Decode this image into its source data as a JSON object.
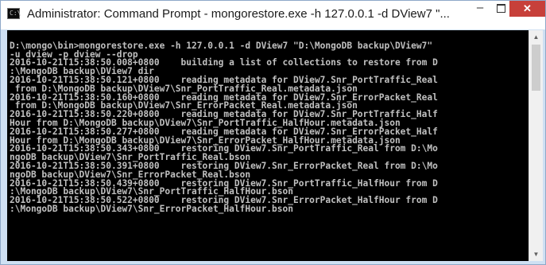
{
  "window": {
    "title": "Administrator: Command Prompt - mongorestore.exe  -h 127.0.0.1 -d DView7 \"...",
    "app_icon": "command-prompt-icon",
    "controls": {
      "minimize_label": "–",
      "close_label": "✕"
    }
  },
  "console": {
    "lines": [
      "",
      "D:\\mongo\\bin>mongorestore.exe -h 127.0.0.1 -d DView7 \"D:\\MongoDB backup\\DView7\"",
      "-u dview -p dview --drop",
      "2016-10-21T15:38:50.008+0800    building a list of collections to restore from D",
      ":\\MongoDB backup\\DView7 dir",
      "2016-10-21T15:38:50.121+0800    reading metadata for DView7.Snr_PortTraffic_Real",
      " from D:\\MongoDB backup\\DView7\\Snr_PortTraffic_Real.metadata.json",
      "2016-10-21T15:38:50.160+0800    reading metadata for DView7.Snr_ErrorPacket_Real",
      " from D:\\MongoDB backup\\DView7\\Snr_ErrorPacket_Real.metadata.json",
      "2016-10-21T15:38:50.220+0800    reading metadata for DView7.Snr_PortTraffic_Half",
      "Hour from D:\\MongoDB backup\\DView7\\Snr_PortTraffic_HalfHour.metadata.json",
      "2016-10-21T15:38:50.277+0800    reading metadata for DView7.Snr_ErrorPacket_Half",
      "Hour from D:\\MongoDB backup\\DView7\\Snr_ErrorPacket_HalfHour.metadata.json",
      "2016-10-21T15:38:50.343+0800    restoring DView7.Snr_PortTraffic_Real from D:\\Mo",
      "ngoDB backup\\DView7\\Snr_PortTraffic_Real.bson",
      "2016-10-21T15:38:50.391+0800    restoring DView7.Snr_ErrorPacket_Real from D:\\Mo",
      "ngoDB backup\\DView7\\Snr_ErrorPacket_Real.bson",
      "2016-10-21T15:38:50.439+0800    restoring DView7.Snr_PortTraffic_HalfHour from D",
      ":\\MongoDB backup\\DView7\\Snr_PortTraffic_HalfHour.bson",
      "2016-10-21T15:38:50.522+0800    restoring DView7.Snr_ErrorPacket_HalfHour from D",
      ":\\MongoDB backup\\DView7\\Snr_ErrorPacket_HalfHour.bson"
    ]
  },
  "scrollbar": {
    "up_icon": "scroll-up-arrow-icon",
    "down_icon": "scroll-down-arrow-icon"
  },
  "colors": {
    "console_background": "#000000",
    "console_text": "#c0c0c0",
    "close_button": "#c7403a"
  }
}
